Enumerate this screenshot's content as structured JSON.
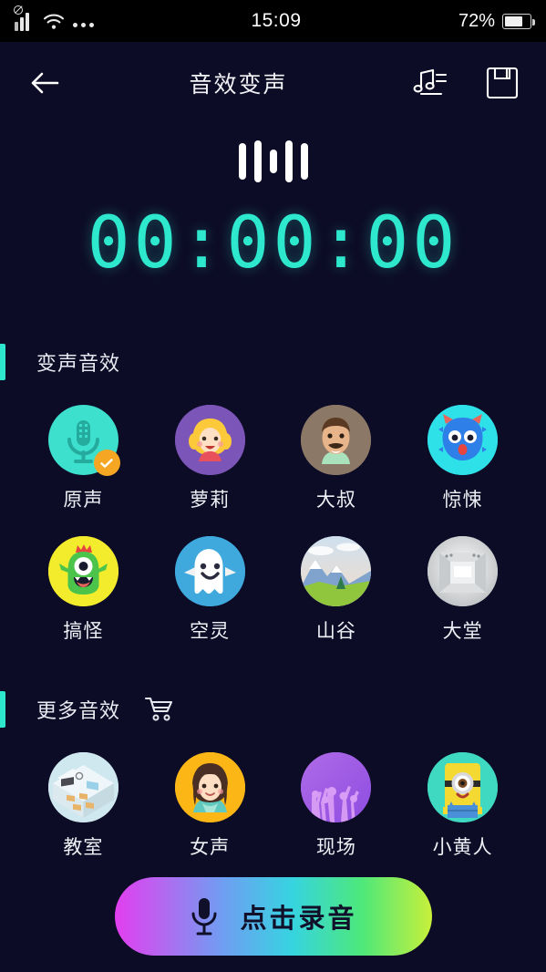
{
  "status_bar": {
    "signal_icon": "signal-bars-no-sim-icon",
    "wifi_icon": "wifi-icon",
    "more_icon": "more-dots-icon",
    "time": "15:09",
    "battery_percent": "72%",
    "battery_level": 72,
    "battery_icon": "battery-icon"
  },
  "header": {
    "back_icon": "back-arrow-icon",
    "title": "音效变声",
    "playlist_icon": "music-list-icon",
    "save_icon": "save-floppy-icon"
  },
  "recorder": {
    "waveform_icon": "audio-waveform-icon",
    "waveform_bars": [
      40,
      46,
      26,
      46,
      40
    ],
    "timer": "00:00:00",
    "timer_color": "#2ee8ce"
  },
  "sections": [
    {
      "title": "变声音效",
      "accent_color": "#2ee8ce",
      "has_cart": false,
      "items": [
        {
          "label": "原声",
          "icon": "microphone-avatar-icon",
          "bg": "#3ce0cd",
          "selected": true
        },
        {
          "label": "萝莉",
          "icon": "girl-blonde-avatar-icon",
          "bg": "#7b55b8",
          "selected": false
        },
        {
          "label": "大叔",
          "icon": "man-mustache-avatar-icon",
          "bg": "#8c7866",
          "selected": false
        },
        {
          "label": "惊悚",
          "icon": "blue-monster-avatar-icon",
          "bg": "#2ee0e8",
          "selected": false
        },
        {
          "label": "搞怪",
          "icon": "green-cyclops-avatar-icon",
          "bg": "#f3ec2c",
          "selected": false
        },
        {
          "label": "空灵",
          "icon": "ghost-avatar-icon",
          "bg": "#3fa9dd",
          "selected": false
        },
        {
          "label": "山谷",
          "icon": "mountain-valley-avatar-icon",
          "bg": "#b9cfe6",
          "selected": false
        },
        {
          "label": "大堂",
          "icon": "hall-room-avatar-icon",
          "bg": "#d9dbdd",
          "selected": false
        }
      ]
    },
    {
      "title": "更多音效",
      "accent_color": "#2ee8ce",
      "has_cart": true,
      "cart_icon": "shopping-cart-icon",
      "items": [
        {
          "label": "教室",
          "icon": "classroom-avatar-icon",
          "bg": "#cfe7ef",
          "selected": false
        },
        {
          "label": "女声",
          "icon": "woman-avatar-icon",
          "bg": "#fcb616",
          "selected": false
        },
        {
          "label": "现场",
          "icon": "concert-crowd-avatar-icon",
          "bg": "#9b57e0",
          "selected": false
        },
        {
          "label": "小黄人",
          "icon": "minion-avatar-icon",
          "bg": "#3fd8c0",
          "selected": false
        }
      ]
    }
  ],
  "record_button": {
    "label": "点击录音",
    "icon": "microphone-icon",
    "gradient_start": "#e23ef0",
    "gradient_end": "#c8f03a"
  }
}
